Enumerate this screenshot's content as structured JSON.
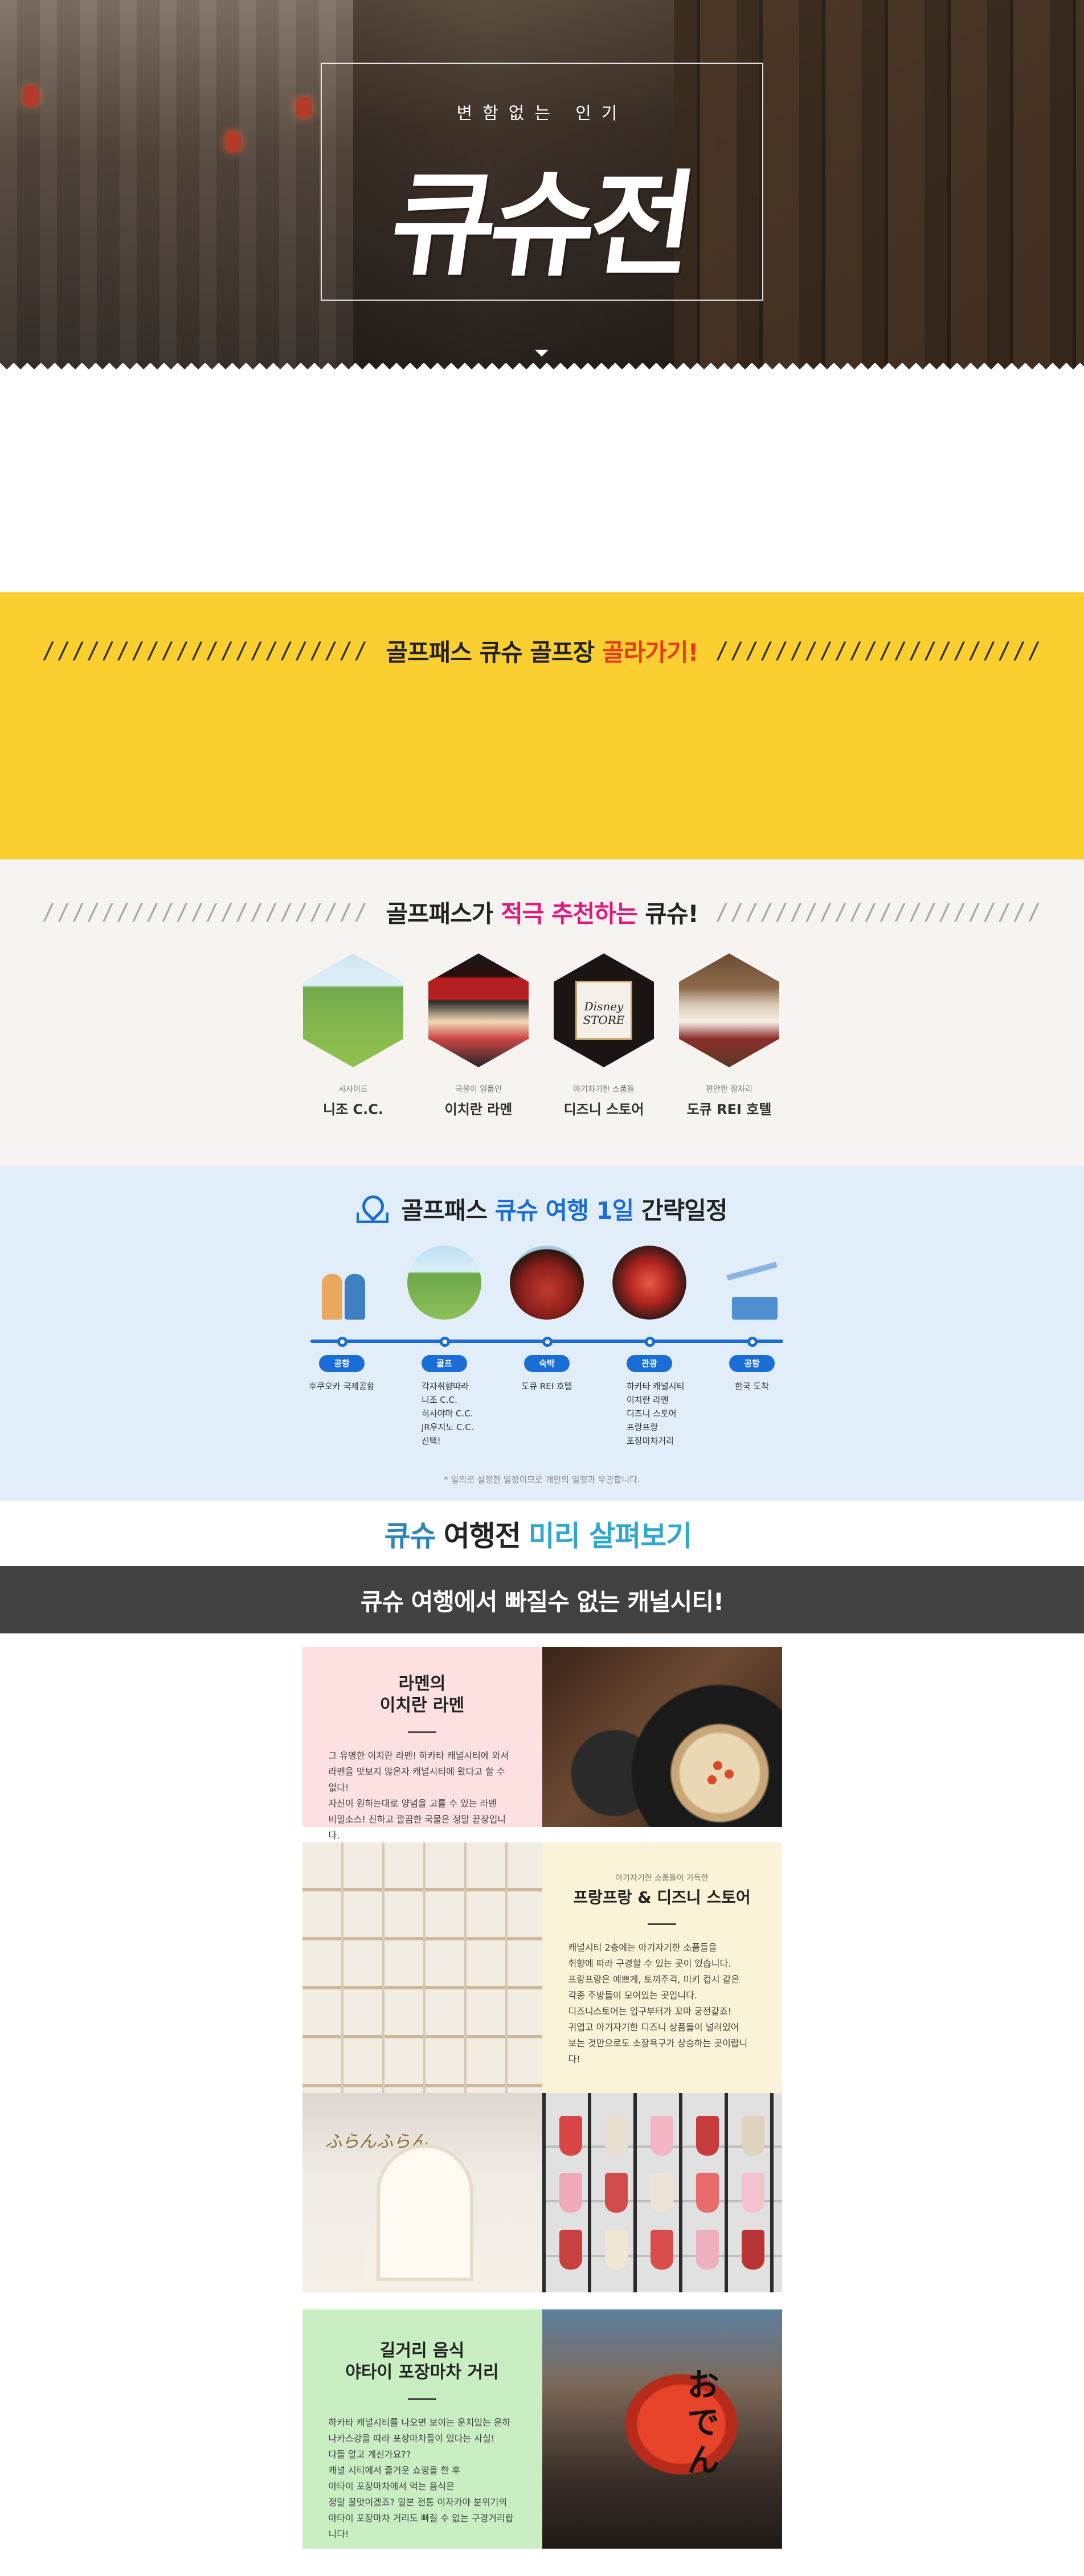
{
  "hero": {
    "subtitle": "변함없는 인기",
    "title": "큐슈전"
  },
  "golf_banner": {
    "slashes_left": "//////////////////////",
    "text_before": "골프패스 큐슈 골프장 ",
    "text_highlight": "골라가기!",
    "slashes_right": "//////////////////////"
  },
  "recommend": {
    "slashes_left": "//////////////////////",
    "text_before": "골프패스가 ",
    "text_highlight": "적극 추천하는",
    "text_after": " 큐슈!",
    "items": [
      {
        "small": "사사이드",
        "name": "니조 C.C."
      },
      {
        "small": "국물이 일품인",
        "name": "이치란 라멘"
      },
      {
        "small": "아기자기한 소품들",
        "name": "디즈니 스토어",
        "logo": "Disney STORE"
      },
      {
        "small": "편안한 잠자리",
        "name": "도큐 REI 호텔"
      }
    ],
    "slashes_right": "//////////////////////"
  },
  "itinerary": {
    "text_before": "골프패스 ",
    "text_highlight": "큐슈 여행 1일",
    "text_after": " 간략일정",
    "stops": [
      {
        "tag": "공항",
        "desc": [
          "후쿠오카 국제공항"
        ]
      },
      {
        "tag": "골프",
        "desc": [
          "각자취향따라",
          "니조 C.C.",
          "히사야마 C.C.",
          "JR우지노 C.C.",
          "선택!"
        ]
      },
      {
        "tag": "숙박",
        "desc": [
          "도큐 REI 호텔"
        ]
      },
      {
        "tag": "관광",
        "desc": [
          "하카타 캐널시티",
          "이치란 라멘",
          "디즈니 스토어",
          "프랑프랑",
          "포장마차거리"
        ]
      },
      {
        "tag": "공항",
        "desc": [
          "한국 도착"
        ]
      }
    ],
    "note": "* 일의로 설정한 일정이므로 개인의 일정과 무관합니다."
  },
  "preview": {
    "part1": "큐슈",
    "part2": "여행전",
    "part3": "미리 살펴보기"
  },
  "canal_bar": "큐슈 여행에서 빠질수 없는 캐널시티!",
  "ramen": {
    "title_line1": "라멘의",
    "title_line2": "이치란 라멘",
    "body": [
      "그 유명한 이치란 라멘! 하카타 캐널시티에 와서",
      "라멘을 맛보지 않은자 캐널시티에 왔다고 할 수 없다!",
      "자신이 원하는대로 양념을 고를 수 있는 라멘",
      "비밀소스! 진하고 깔끔한 국물은 정말 끝장입니다."
    ]
  },
  "shop": {
    "small": "아기자기한 소품들이 가득한",
    "title": "프랑프랑 & 디즈니 스토어",
    "body": [
      "캐널시티 2층에는 아기자기한 소품들을",
      "취향에 따라 구경할 수 있는 곳이 있습니다.",
      "프랑프랑은 예쁘게, 토끼주걱, 미키 컵시 같은",
      "각종 주방들이 모여있는 곳입니다.",
      "디즈니스토어는 입구부터가 꼬마 궁전같죠!",
      "귀엽고 아기자기한 디즈니 상품들이 널려있어",
      "보는 것만으로도 소장욕구가 상승하는 곳이랍니다!"
    ]
  },
  "store_photo": {
    "sign": "ふらんふらん"
  },
  "street": {
    "title_line1": "길거리 음식",
    "title_line2": "야타이 포장마차 거리",
    "body": [
      "하카타 캐널시티를 나오면 보이는 운치있는 운하",
      "나카스강을 따라 포장마차들이 있다는 사실!",
      "다들 알고 계신가요??",
      "캐널 시티에서 즐거운 쇼핑을 한 후",
      "야타이 포장마차에서 먹는 음식은",
      "정말 꿀맛이겠죠? 일본 전통 이자카야 분위기의",
      "야타이 포장마차 거리도 빠질 수 없는 구경거리랍니다!"
    ],
    "lantern_text": "おでん"
  }
}
